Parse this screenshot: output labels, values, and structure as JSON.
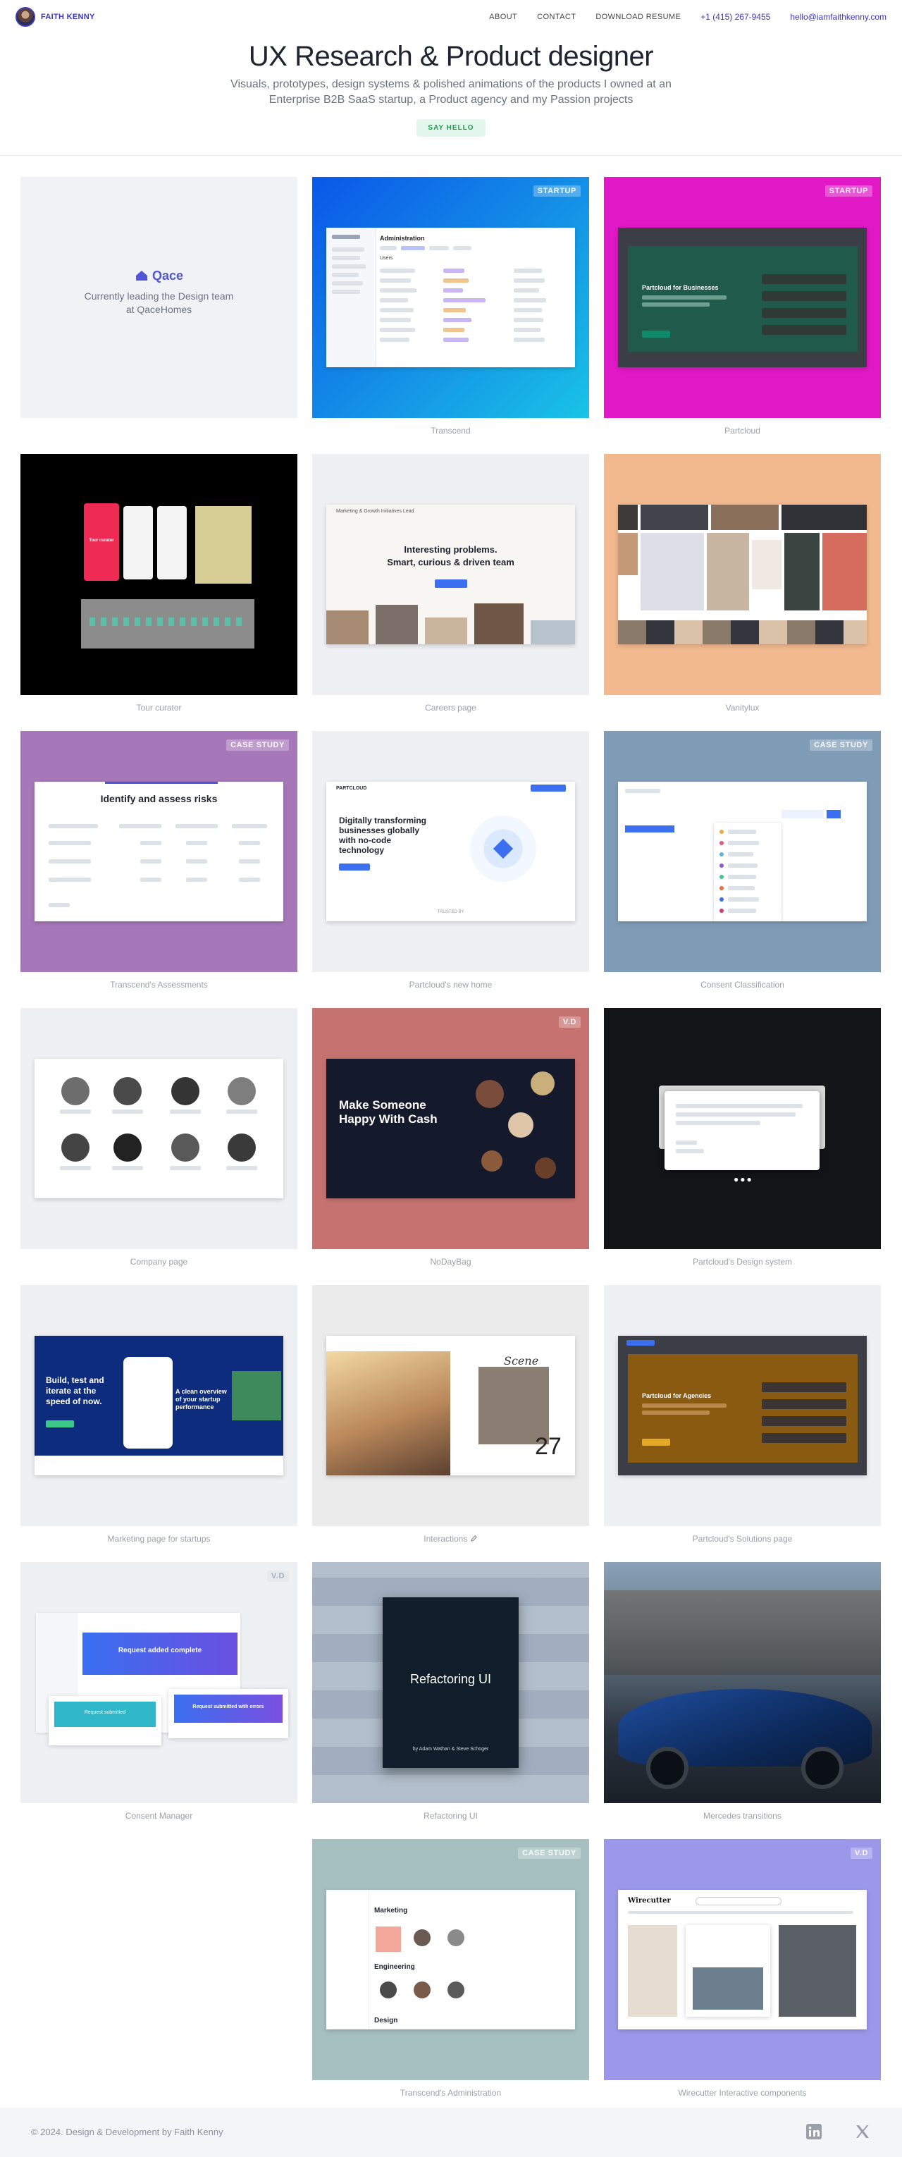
{
  "nav": {
    "brand": "FAITH KENNY",
    "links": [
      "ABOUT",
      "CONTACT",
      "DOWNLOAD RESUME"
    ],
    "phone": "+1 (415) 267-9455",
    "email": "hello@iamfaithkenny.com"
  },
  "hero": {
    "title": "UX Research & Product designer",
    "subtitle": "Visuals, prototypes, design systems & polished animations of the products I owned at an Enterprise B2B SaaS startup, a Product agency and my Passion projects",
    "cta": "SAY HELLO"
  },
  "qace": {
    "logo": "Qace",
    "text": "Currently leading the Design team at QaceHomes"
  },
  "tiles": {
    "transcend": {
      "caption": "Transcend",
      "badge": "STARTUP",
      "screen_title": "Administration",
      "screen_subtitle": "Users",
      "bg": "#1c8ae6"
    },
    "partcloud": {
      "caption": "Partcloud",
      "badge": "STARTUP",
      "banner": "Partcloud for Businesses",
      "bg": "#e018c5"
    },
    "tour_curator": {
      "caption": "Tour curator",
      "card": "Tour curator",
      "bg": "#000000"
    },
    "careers": {
      "caption": "Careers page",
      "headline_1": "Interesting problems.",
      "headline_2": "Smart, curious & driven team",
      "top_label": "Marketing & Growth Initiatives Lead"
    },
    "vanitylux": {
      "caption": "Vanitylux",
      "bg": "#f2b98e"
    },
    "assessments": {
      "caption": "Transcend's Assessments",
      "badge": "CASE STUDY",
      "headline": "Identify and assess risks",
      "bg": "#a678b9"
    },
    "partcloud_home": {
      "caption": "Partcloud's new home",
      "logo": "PARTCLOUD",
      "headline": "Digitally transforming businesses globally with no-code technology",
      "trusted": "TRUSTED BY"
    },
    "consent": {
      "caption": "Consent Classification",
      "badge": "CASE STUDY",
      "bg": "#7f9cb7"
    },
    "company": {
      "caption": "Company page"
    },
    "nodaybag": {
      "caption": "NoDayBag",
      "badge": "V.D",
      "headline": "Make Someone Happy With Cash",
      "bg": "#c67271"
    },
    "design_system": {
      "caption": "Partcloud's Design system",
      "bg": "#121418"
    },
    "marketing": {
      "caption": "Marketing page for startups",
      "headline": "Build, test and iterate at the speed of now.",
      "card": "A clean overview of your startup performance"
    },
    "interactions": {
      "caption": "Interactions",
      "scene": "Scene",
      "number": "27"
    },
    "solutions": {
      "caption": "Partcloud's Solutions page",
      "banner": "Partcloud for Agencies"
    },
    "consent_manager": {
      "caption": "Consent Manager",
      "badge": "V.D",
      "panel_1": "Request added complete",
      "panel_2": "Request submitted",
      "panel_3": "Request submitted with errors"
    },
    "refactoring": {
      "caption": "Refactoring UI",
      "book_title": "Refactoring UI",
      "book_authors": "by Adam Wathan & Steve Schoger"
    },
    "mercedes": {
      "caption": "Mercedes transitions"
    },
    "admin": {
      "caption": "Transcend's Administration",
      "badge": "CASE STUDY",
      "group_1": "Marketing",
      "group_2": "Engineering",
      "group_3": "Design"
    },
    "wirecutter": {
      "caption": "Wirecutter Interactive components",
      "badge": "V.D",
      "brand": "Wirecutter",
      "bg": "#9b98ea"
    }
  },
  "footer": {
    "copyright": "© 2024. Design & Development by Faith Kenny",
    "icons": [
      "linkedin-icon",
      "x-icon"
    ]
  }
}
